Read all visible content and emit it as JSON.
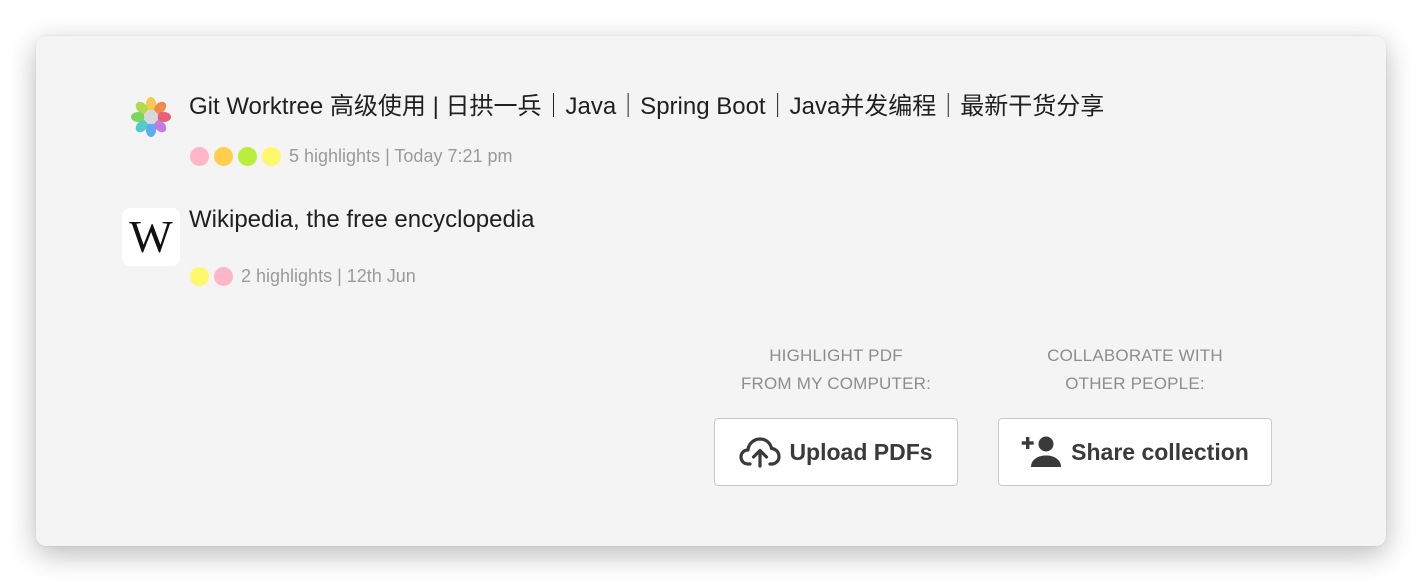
{
  "items": [
    {
      "title": "Git Worktree 高级使用 | 日拱一兵｜Java｜Spring Boot｜Java并发编程｜最新干货分享",
      "favicon": "pinwheel-icon",
      "dots": [
        "#ffb6c9",
        "#ffcf4d",
        "#b9ef3c",
        "#fff86a"
      ],
      "meta": "5 highlights | Today 7:21 pm"
    },
    {
      "title": "Wikipedia, the free encyclopedia",
      "favicon": "wikipedia-icon",
      "favicon_text": "W",
      "dots": [
        "#fff86a",
        "#ffb6c9"
      ],
      "meta": "2 highlights | 12th Jun"
    }
  ],
  "actions": {
    "upload": {
      "caption": "HIGHLIGHT PDF\nFROM MY COMPUTER:",
      "label": "Upload PDFs",
      "icon": "cloud-upload-icon"
    },
    "share": {
      "caption": "COLLABORATE WITH\nOTHER PEOPLE:",
      "label": "Share collection",
      "icon": "add-person-icon"
    }
  },
  "colors": {
    "card_background": "#f4f4f4",
    "title_text": "#1f1f1f",
    "meta_text": "#9a9a9a",
    "caption_text": "#8d8d8d",
    "button_text": "#3a3a3a"
  }
}
